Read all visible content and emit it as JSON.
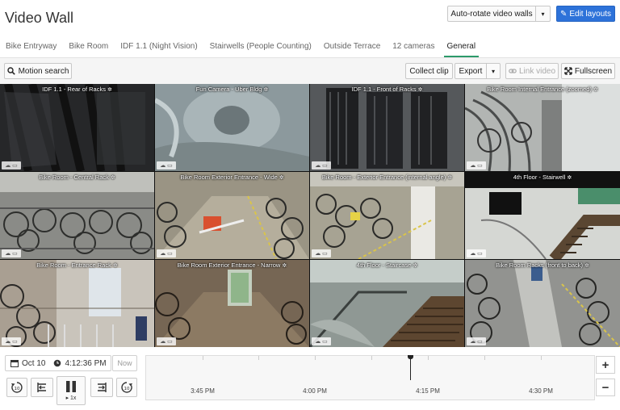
{
  "header": {
    "title": "Video Wall",
    "rotate_label": "Auto-rotate video walls",
    "caret": "▾",
    "edit_label": "Edit layouts",
    "edit_icon": "✎"
  },
  "tabs": [
    {
      "label": "Bike Entryway"
    },
    {
      "label": "Bike Room"
    },
    {
      "label": "IDF 1.1 (Night Vision)"
    },
    {
      "label": "Stairwells (People Counting)"
    },
    {
      "label": "Outside Terrace"
    },
    {
      "label": "12 cameras"
    },
    {
      "label": "General",
      "active": true
    }
  ],
  "toolbar": {
    "motion_search": "Motion search",
    "collect_clip": "Collect clip",
    "export": "Export",
    "link_video": "Link video",
    "fullscreen": "Fullscreen"
  },
  "cameras": [
    {
      "title": "IDF 1.1 - Rear of Racks",
      "color": "#2a2b2e"
    },
    {
      "title": "Fun Camera - Uber Bldg",
      "color": "#8d9a9e"
    },
    {
      "title": "IDF 1.1 - Front of Racks",
      "color": "#4a4d50"
    },
    {
      "title": "Bike Room Internal Entrance (zoomed)",
      "color": "#9fa3a2"
    },
    {
      "title": "Bike Room - Central Rack",
      "color": "#7f807c"
    },
    {
      "title": "Bike Room Exterior Entrance - Wide",
      "color": "#8b8676"
    },
    {
      "title": "Bike Room - Exterior Entrance (internal angle)",
      "color": "#a29e8e"
    },
    {
      "title": "4th Floor - Stairwell",
      "color": "#8a8d88"
    },
    {
      "title": "Bike Room - Entrance Rack",
      "color": "#a0968a"
    },
    {
      "title": "Bike Room Exterior Entrance - Narrow",
      "color": "#7a6b58"
    },
    {
      "title": "4th Floor - Staircase",
      "color": "#87908c"
    },
    {
      "title": "Bike Room Racks (front to back)",
      "color": "#8e8f8a"
    }
  ],
  "tile_tag": "☁ ▭",
  "bottom": {
    "date": "Oct 10",
    "time": "4:12:36 PM",
    "now": "Now",
    "speed": "▸ 1x",
    "timeline_labels": [
      "3:45 PM",
      "4:00 PM",
      "4:15 PM",
      "4:30 PM"
    ],
    "zoom_in": "+",
    "zoom_out": "−"
  },
  "colors": {
    "accent": "#2d72d9",
    "active_tab": "#2c9a6a"
  }
}
